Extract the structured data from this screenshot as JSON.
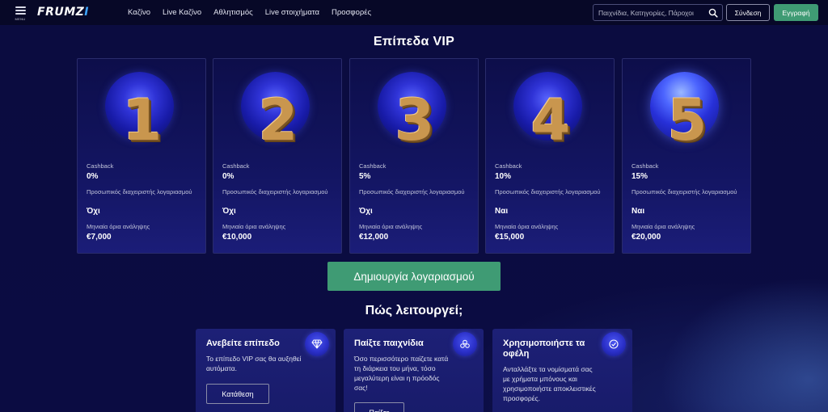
{
  "header": {
    "menu_label": "MENU",
    "logo": {
      "main": "FRUMZ",
      "accent": "I"
    },
    "nav": [
      "Καζίνο",
      "Live Καζίνο",
      "Αθλητισμός",
      "Live στοιχήματα",
      "Προσφορές"
    ],
    "search_placeholder": "Παιχνίδια, Κατηγορίες, Πάροχοι",
    "login": "Σύνδεση",
    "register": "Εγγραφή"
  },
  "vip": {
    "title": "Επίπεδα VIP",
    "labels": {
      "cashback": "Cashback",
      "manager": "Προσωπικός διαχειριστής λογαριασμού",
      "limit": "Μηνιαία όρια ανάληψης"
    },
    "levels": [
      {
        "num": "1",
        "cashback": "0%",
        "manager": "Όχι",
        "limit": "€7,000"
      },
      {
        "num": "2",
        "cashback": "0%",
        "manager": "Όχι",
        "limit": "€10,000"
      },
      {
        "num": "3",
        "cashback": "5%",
        "manager": "Όχι",
        "limit": "€12,000"
      },
      {
        "num": "4",
        "cashback": "10%",
        "manager": "Ναι",
        "limit": "€15,000"
      },
      {
        "num": "5",
        "cashback": "15%",
        "manager": "Ναι",
        "limit": "€20,000"
      }
    ],
    "cta": "Δημιουργία λογαριασμού"
  },
  "how": {
    "title": "Πώς λειτουργεί;",
    "steps": [
      {
        "title": "Ανεβείτε επίπεδο",
        "text": "Το επίπεδο VIP σας θα αυξηθεί αυτόματα.",
        "button": "Κατάθεση",
        "icon": "diamond-icon"
      },
      {
        "title": "Παίξτε παιχνίδια",
        "text": "Όσο περισσότερο παίζετε κατά τη διάρκεια του μήνα, τόσο μεγαλύτερη είναι η πρόοδός σας!",
        "button": "Παίξτε",
        "icon": "chips-icon"
      },
      {
        "title": "Χρησιμοποιήστε τα οφέλη",
        "text": "Ανταλλάξτε τα νομίσματά σας με χρήματα μπόνους και χρησιμοποιήστε αποκλειστικές προσφορές.",
        "button": "",
        "icon": "check-badge-icon"
      }
    ]
  },
  "colors": {
    "accent_green": "#3f9b74",
    "background": "#0a0b3d",
    "gold": "#c9964e"
  }
}
